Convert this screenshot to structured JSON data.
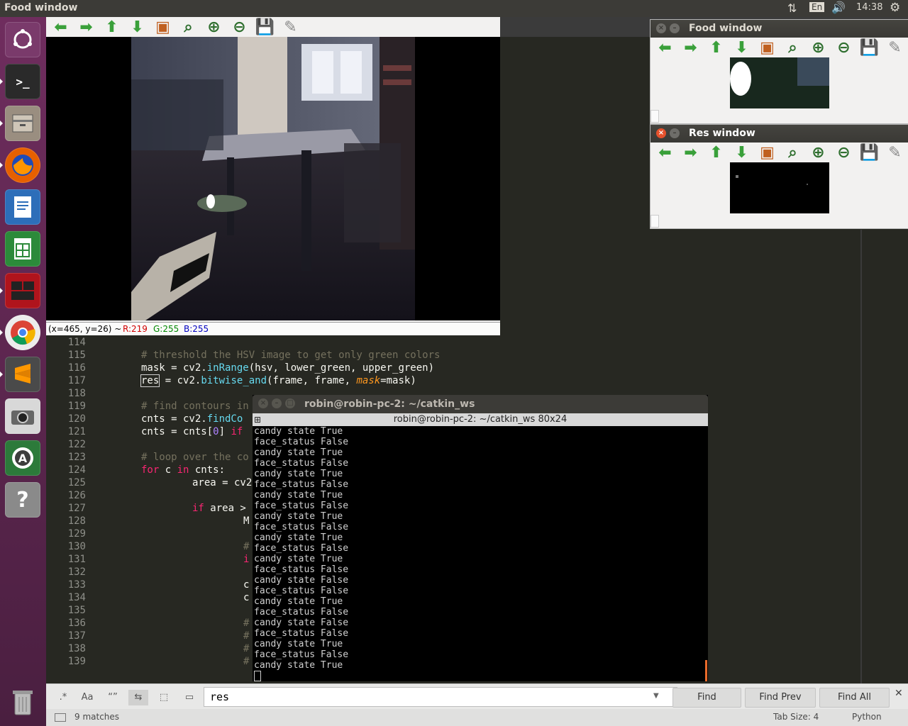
{
  "top_panel": {
    "title": "Food window",
    "keyboard": "En",
    "clock": "14:38"
  },
  "launcher": {
    "items": [
      "Ubuntu Dash",
      "Terminal",
      "Files",
      "Firefox",
      "LibreOffice Writer",
      "LibreOffice Calc",
      "Terminator",
      "Chrome",
      "Sublime Text",
      "Cheese",
      "Software Updater",
      "Help",
      "Trash"
    ]
  },
  "cv_main": {
    "coord_text": "(x=465, y=26) ~",
    "r": "R:219",
    "g": "G:255",
    "b": "B:255"
  },
  "food_window": {
    "title": "Food window"
  },
  "res_window": {
    "title": "Res window"
  },
  "editor": {
    "lines": [
      {
        "n": "114",
        "code": ""
      },
      {
        "n": "115",
        "code": ""
      },
      {
        "n": "116",
        "code": ""
      },
      {
        "n": "117",
        "code": ""
      },
      {
        "n": "118",
        "code": ""
      },
      {
        "n": "119",
        "code": ""
      },
      {
        "n": "120",
        "code": ""
      },
      {
        "n": "121",
        "code": ""
      },
      {
        "n": "122",
        "code": ""
      },
      {
        "n": "123",
        "code": ""
      },
      {
        "n": "124",
        "code": ""
      },
      {
        "n": "125",
        "code": ""
      },
      {
        "n": "126",
        "code": ""
      },
      {
        "n": "127",
        "code": ""
      },
      {
        "n": "128",
        "code": ""
      },
      {
        "n": "129",
        "code": ""
      },
      {
        "n": "130",
        "code": ""
      },
      {
        "n": "131",
        "code": ""
      },
      {
        "n": "132",
        "code": ""
      },
      {
        "n": "133",
        "code": ""
      },
      {
        "n": "134",
        "code": ""
      },
      {
        "n": "135",
        "code": ""
      },
      {
        "n": "136",
        "code": ""
      },
      {
        "n": "137",
        "code": ""
      },
      {
        "n": "138",
        "code": ""
      },
      {
        "n": "139",
        "code": ""
      }
    ],
    "code_115": "# threshold the HSV image to get only green colors",
    "code_116_a": "mask = cv2.",
    "code_116_fn": "inRange",
    "code_116_b": "(hsv, lower_green, upper_green)",
    "code_117_res": "res",
    "code_117_a": " = cv2.",
    "code_117_fn": "bitwise_and",
    "code_117_b": "(frame, frame, ",
    "code_117_kw": "mask",
    "code_117_c": "=mask)",
    "code_119": "# find contours in",
    "code_120_a": "cnts = cv2.",
    "code_120_fn": "findCo",
    "code_121_a": "cnts = cnts[",
    "code_121_num": "0",
    "code_121_b": "] ",
    "code_121_kw": "if",
    "code_123": "# loop over the co",
    "code_124_kw1": "for",
    "code_124_a": " c ",
    "code_124_kw2": "in",
    "code_124_b": " cnts:",
    "code_125": "area = cv2",
    "code_127_kw": "if",
    "code_127_a": " area >",
    "code_128": "M",
    "code_130": "#",
    "code_131": "i",
    "code_133": "c",
    "code_134": "c",
    "code_136": "#",
    "code_137": "#",
    "code_138": "#",
    "code_139": "#"
  },
  "terminal": {
    "title": "robin@robin-pc-2: ~/catkin_ws",
    "subtitle": "robin@robin-pc-2: ~/catkin_ws 80x24",
    "lines": [
      "candy state True",
      "face_status False",
      "candy state True",
      "face_status False",
      "candy state True",
      "face_status False",
      "candy state True",
      "face_status False",
      "candy state True",
      "face_status False",
      "candy state True",
      "face_status False",
      "candy state True",
      "face_status False",
      "candy state False",
      "face_status False",
      "candy state True",
      "face_status False",
      "candy state False",
      "face_status False",
      "candy state True",
      "face_status False",
      "candy state True"
    ]
  },
  "findbar": {
    "regex": ".*",
    "case": "Aa",
    "word": "“”",
    "query": "res",
    "find": "Find",
    "find_prev": "Find Prev",
    "find_all": "Find All"
  },
  "statusbar": {
    "matches": "9 matches",
    "tab_size": "Tab Size: 4",
    "syntax": "Python"
  }
}
